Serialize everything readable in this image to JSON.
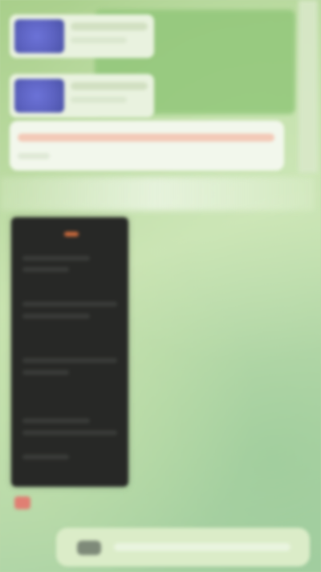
{
  "app": {
    "type": "chat-screen"
  },
  "colors": {
    "wallpaper": "#bcd7a7",
    "dark_card": "#272826",
    "accent": "#c9693b",
    "media_thumb": "#5c62c0",
    "small_icon": "#e07f73"
  },
  "messages": [
    {
      "kind": "media",
      "icon": "video-thumbnail-icon"
    },
    {
      "kind": "media",
      "icon": "video-thumbnail-icon"
    },
    {
      "kind": "text"
    }
  ],
  "screenshot_card": {
    "icon": "screenshot-image-icon"
  },
  "composer": {
    "icon": "attachment-icon",
    "placeholder": ""
  }
}
